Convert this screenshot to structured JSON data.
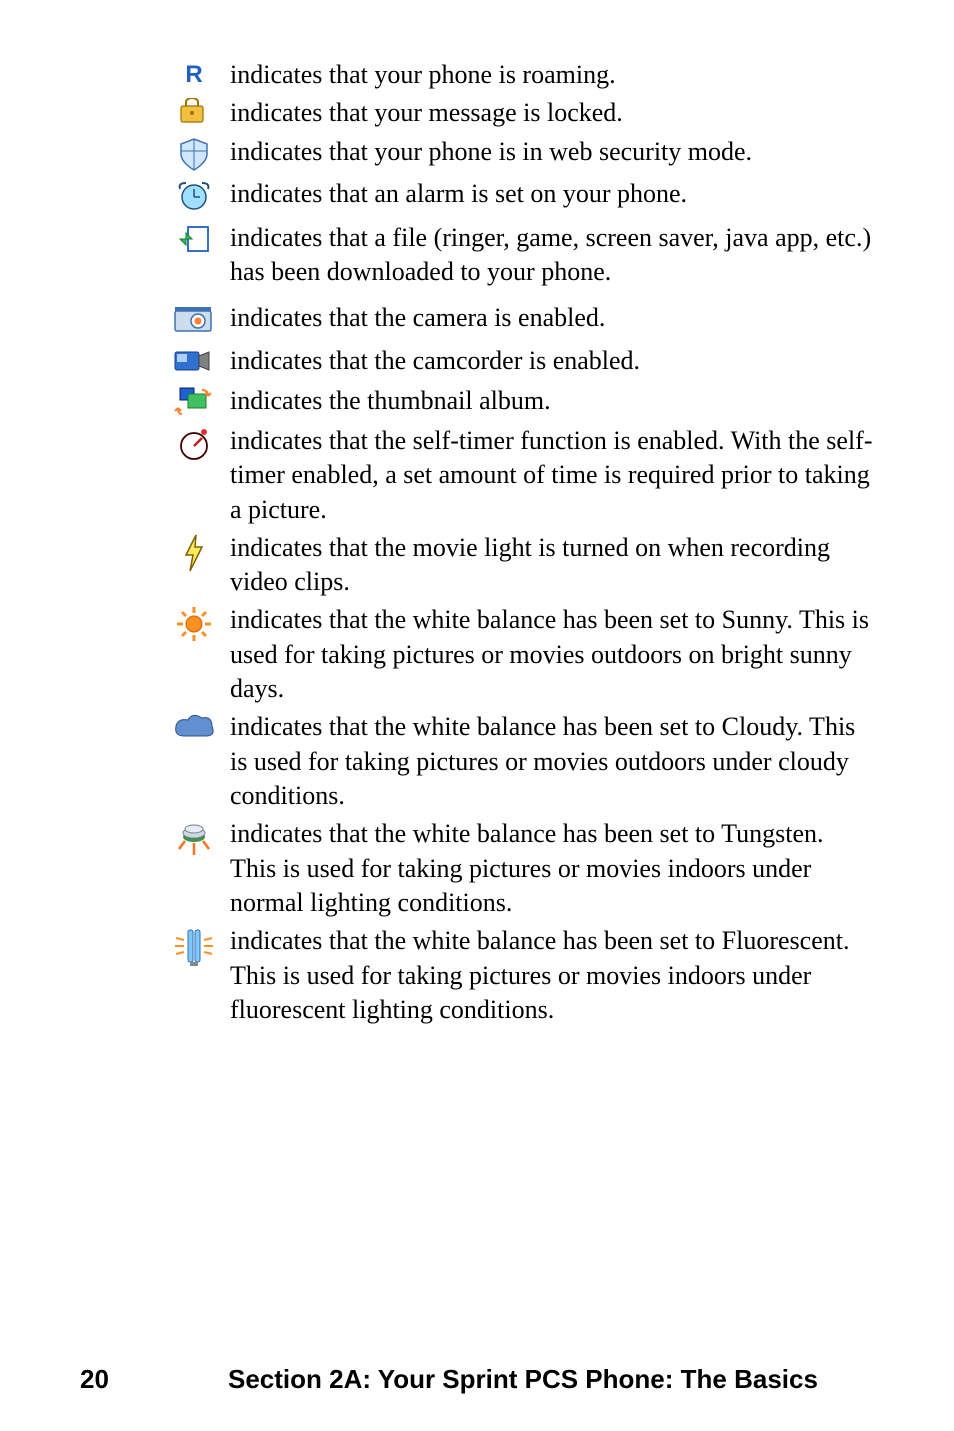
{
  "rows": [
    {
      "icon": "roaming-icon",
      "text": "indicates that your phone is roaming."
    },
    {
      "icon": "locked-message-icon",
      "text": "indicates that your message is locked."
    },
    {
      "icon": "web-security-icon",
      "text": "indicates that your phone is in web security mode."
    },
    {
      "icon": "alarm-icon",
      "text": "indicates that an alarm is set on your phone."
    },
    {
      "icon": "download-icon",
      "text": "indicates that a file (ringer, game, screen saver, java app, etc.) has been downloaded to your phone."
    },
    {
      "icon": "camera-icon",
      "text": "indicates that the camera is enabled."
    },
    {
      "icon": "camcorder-icon",
      "text": "indicates that the camcorder is enabled."
    },
    {
      "icon": "thumbnail-album-icon",
      "text": "indicates the thumbnail album."
    },
    {
      "icon": "self-timer-icon",
      "text": "indicates that the self-timer function is enabled. With the self-timer enabled, a set amount of time is required prior to taking a picture."
    },
    {
      "icon": "movie-light-icon",
      "text": "indicates that the movie light is turned on when recording video clips."
    },
    {
      "icon": "wb-sunny-icon",
      "text": "indicates that the white balance has been set to Sunny. This is used for taking pictures or movies outdoors on bright sunny days."
    },
    {
      "icon": "wb-cloudy-icon",
      "text": "indicates that the white balance has been set to Cloudy. This is used for taking pictures or movies outdoors under cloudy conditions."
    },
    {
      "icon": "wb-tungsten-icon",
      "text": "indicates that the white balance has been set to Tungsten. This is used for taking pictures or movies indoors under normal lighting conditions."
    },
    {
      "icon": "wb-fluorescent-icon",
      "text": "indicates that the white balance has been set to Fluorescent. This is used for taking pictures or movies indoors under fluorescent lighting conditions."
    }
  ],
  "footer": {
    "page_number": "20",
    "section_title": "Section 2A: Your Sprint PCS Phone: The Basics"
  }
}
